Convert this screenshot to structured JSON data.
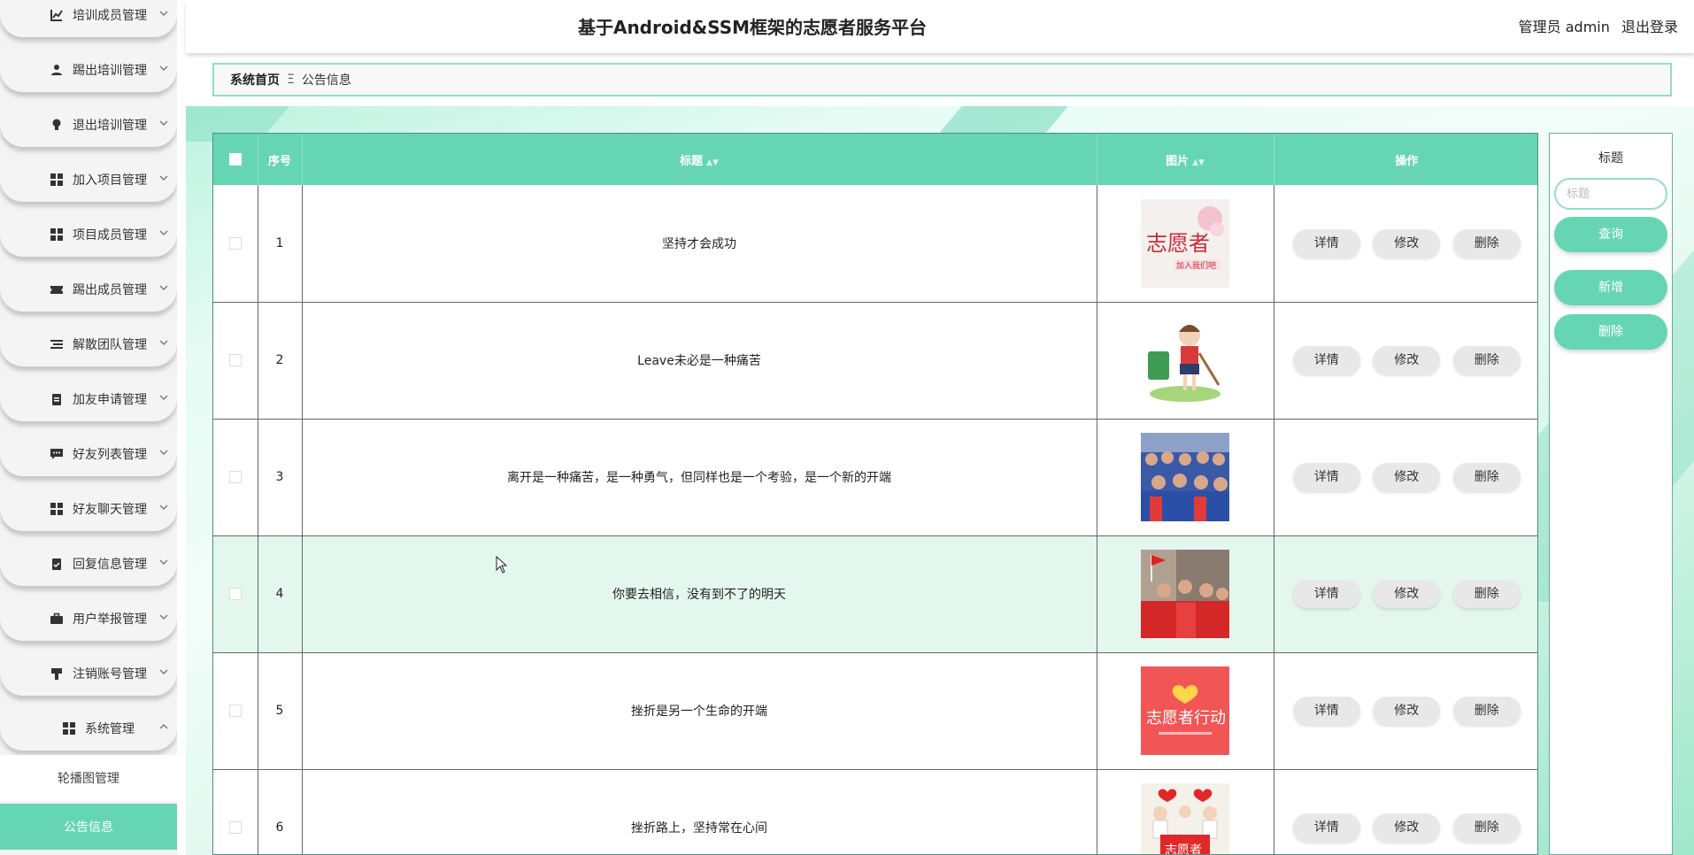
{
  "header": {
    "title": "基于Android&SSM框架的志愿者服务平台",
    "user": "管理员 admin",
    "logout": "退出登录"
  },
  "sidebar": {
    "items": [
      {
        "label": "培训成员管理",
        "icon": "chart-icon"
      },
      {
        "label": "踢出培训管理",
        "icon": "user-icon"
      },
      {
        "label": "退出培训管理",
        "icon": "bulb-icon"
      },
      {
        "label": "加入项目管理",
        "icon": "grid-icon"
      },
      {
        "label": "项目成员管理",
        "icon": "grid-icon"
      },
      {
        "label": "踢出成员管理",
        "icon": "ticket-icon"
      },
      {
        "label": "解散团队管理",
        "icon": "list-icon"
      },
      {
        "label": "加友申请管理",
        "icon": "clipboard-icon"
      },
      {
        "label": "好友列表管理",
        "icon": "message-icon"
      },
      {
        "label": "好友聊天管理",
        "icon": "grid-icon"
      },
      {
        "label": "回复信息管理",
        "icon": "clipboard-check-icon"
      },
      {
        "label": "用户举报管理",
        "icon": "briefcase-icon"
      },
      {
        "label": "注销账号管理",
        "icon": "stamp-icon"
      },
      {
        "label": "系统管理",
        "icon": "grid-icon"
      }
    ],
    "subitems": [
      {
        "label": "轮播图管理"
      },
      {
        "label": "公告信息"
      }
    ]
  },
  "breadcrumb": {
    "home": "系统首页",
    "sep": "Ξ",
    "current": "公告信息"
  },
  "table": {
    "headers": {
      "index": "序号",
      "title": "标题",
      "image": "图片",
      "actions": "操作"
    },
    "rows": [
      {
        "index": "1",
        "title": "坚持才会成功",
        "image": "volunteer-join-poster"
      },
      {
        "index": "2",
        "title": "Leave未必是一种痛苦",
        "image": "cartoon-volunteer-girl"
      },
      {
        "index": "3",
        "title": "离开是一种痛苦，是一种勇气，但同样也是一个考验，是一个新的开端",
        "image": "volunteer-group-blue"
      },
      {
        "index": "4",
        "title": "你要去相信，没有到不了的明天",
        "image": "volunteer-group-red"
      },
      {
        "index": "5",
        "title": "挫折是另一个生命的开端",
        "image": "volunteer-action-poster"
      },
      {
        "index": "6",
        "title": "挫折路上，坚持常在心间",
        "image": "volunteer-banner-poster"
      }
    ],
    "actions": {
      "detail": "详情",
      "edit": "修改",
      "delete": "删除"
    }
  },
  "search": {
    "label": "标题",
    "placeholder": "标题",
    "query": "查询",
    "add": "新增",
    "delete": "删除"
  },
  "colors": {
    "accent": "#66d6b2",
    "hover_row": "#e3f7ef"
  }
}
